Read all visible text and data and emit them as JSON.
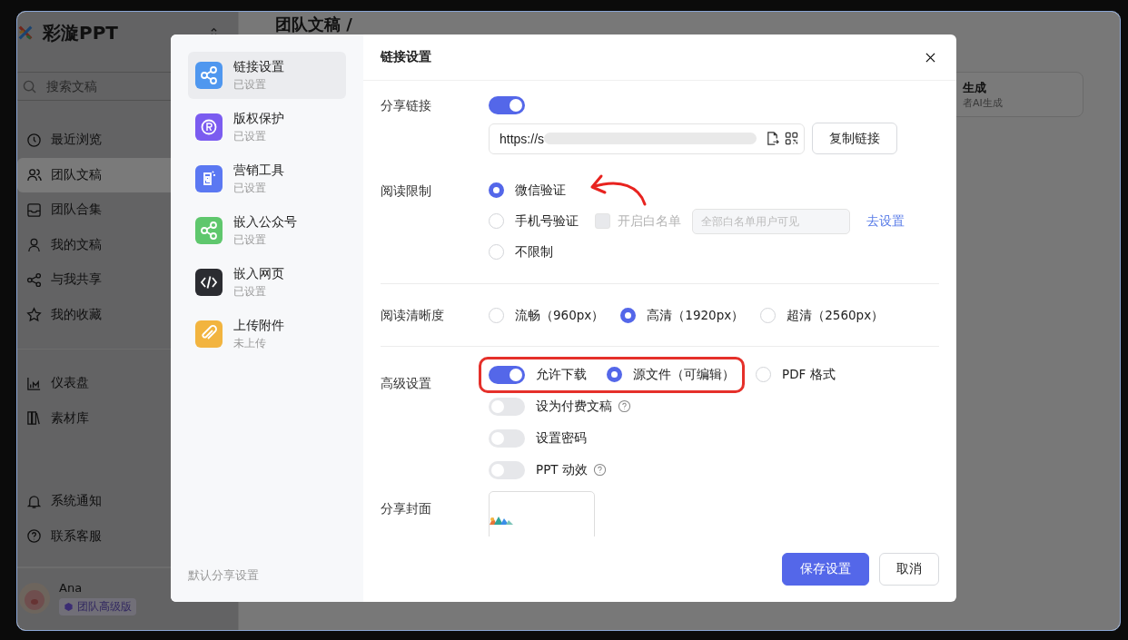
{
  "app": {
    "brand": "彩漩PPT",
    "search": {
      "placeholder": "搜索文稿"
    },
    "nav": [
      {
        "label": "最近浏览",
        "selected": false
      },
      {
        "label": "团队文稿",
        "selected": true
      },
      {
        "label": "团队合集",
        "selected": false
      },
      {
        "label": "我的文稿",
        "selected": false
      },
      {
        "label": "与我共享",
        "selected": false
      },
      {
        "label": "我的收藏",
        "selected": false
      }
    ],
    "nav_tools": [
      {
        "label": "仪表盘",
        "selected": false
      },
      {
        "label": "素材库",
        "selected": false
      }
    ],
    "nav_bottom": [
      {
        "label": "系统通知",
        "selected": false
      },
      {
        "label": "联系客服",
        "selected": false
      }
    ],
    "user": {
      "name": "Ana",
      "plan": "团队高级版"
    },
    "breadcrumb": "团队文稿 /",
    "card": {
      "title": "生成",
      "subtitle": "者AI生成"
    }
  },
  "dialog": {
    "menu": [
      {
        "label": "链接设置",
        "status": "已设置",
        "color": "#4f97ef",
        "selected": true
      },
      {
        "label": "版权保护",
        "status": "已设置",
        "color": "#7b5cf0",
        "selected": false
      },
      {
        "label": "营销工具",
        "status": "已设置",
        "color": "#5b78f2",
        "selected": false
      },
      {
        "label": "嵌入公众号",
        "status": "已设置",
        "color": "#5fc76d",
        "selected": false
      },
      {
        "label": "嵌入网页",
        "status": "已设置",
        "color": "#2b2c31",
        "selected": false
      },
      {
        "label": "上传附件",
        "status": "未上传",
        "color": "#f2b43f",
        "selected": false
      }
    ],
    "default_note": "默认分享设置",
    "title": "链接设置",
    "share_link": {
      "label": "分享链接",
      "on": true,
      "url": "https://s",
      "copy_button": "复制链接"
    },
    "read_limit": {
      "label": "阅读限制",
      "options": [
        {
          "label": "微信验证",
          "selected": true
        },
        {
          "label": "手机号验证",
          "selected": false
        },
        {
          "label": "不限制",
          "selected": false
        }
      ],
      "whitelist": {
        "label": "开启白名单",
        "checked": false,
        "disabled": true,
        "placeholder": "全部白名单用户可见"
      },
      "link": "去设置"
    },
    "clarity": {
      "label": "阅读清晰度",
      "options": [
        {
          "label": "流畅（960px）",
          "selected": false
        },
        {
          "label": "高清（1920px）",
          "selected": true
        },
        {
          "label": "超清（2560px）",
          "selected": false
        }
      ]
    },
    "advanced": {
      "label": "高级设置",
      "download": {
        "label": "允许下载",
        "on": true
      },
      "formats": [
        {
          "label": "源文件（可编辑）",
          "selected": true
        },
        {
          "label": "PDF 格式",
          "selected": false
        }
      ],
      "toggles": [
        {
          "label": "设为付费文稿",
          "on": false,
          "help": true
        },
        {
          "label": "设置密码",
          "on": false,
          "help": false
        },
        {
          "label": "PPT 动效",
          "on": false,
          "help": true
        }
      ]
    },
    "cover": {
      "label": "分享封面"
    },
    "buttons": {
      "save": "保存设置",
      "cancel": "取消"
    }
  }
}
